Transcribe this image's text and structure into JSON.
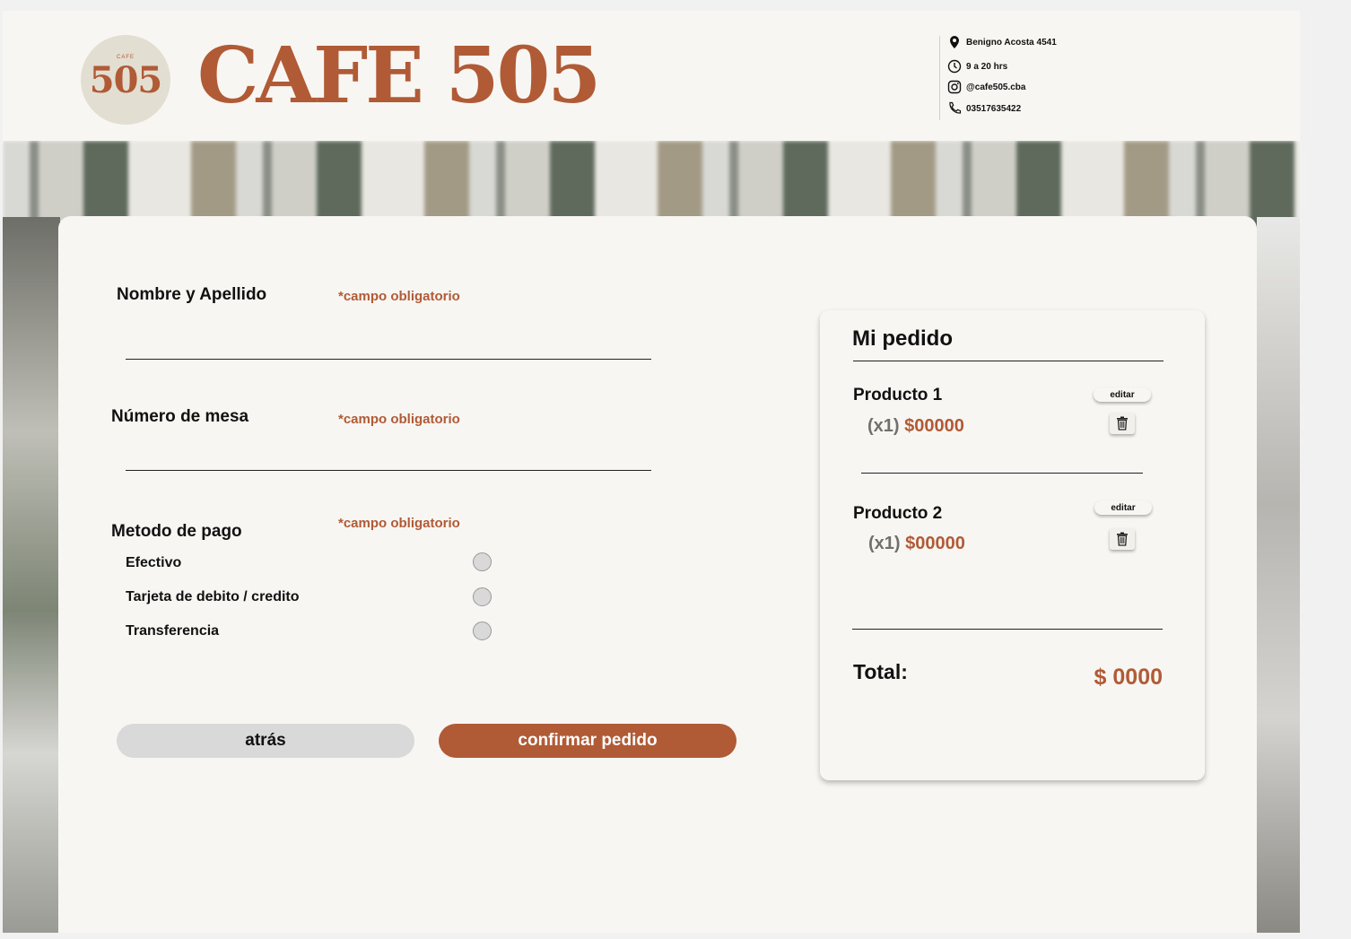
{
  "brand": {
    "badge_number": "505",
    "badge_small": "CAFE",
    "title": "CAFE 505",
    "accent_color": "#b15a36"
  },
  "contact": {
    "address": "Benigno Acosta 4541",
    "hours": "9 a 20 hrs",
    "instagram": "@cafe505.cba",
    "phone": "03517635422",
    "icons": [
      "location-pin-icon",
      "clock-icon",
      "instagram-icon",
      "phone-icon"
    ]
  },
  "form": {
    "name": {
      "label": "Nombre y Apellido",
      "required": "*campo obligatorio",
      "value": ""
    },
    "table": {
      "label": "Número de mesa",
      "required": "*campo obligatorio",
      "value": ""
    },
    "payment": {
      "label": "Metodo de pago",
      "required": "*campo obligatorio",
      "options": [
        "Efectivo",
        "Tarjeta de debito / credito",
        "Transferencia"
      ]
    },
    "back_label": "atrás",
    "confirm_label": "confirmar pedido"
  },
  "order": {
    "title": "Mi pedido",
    "items": [
      {
        "name": "Producto 1",
        "qty": "(x1)",
        "price": "$00000",
        "edit_label": "editar"
      },
      {
        "name": "Producto 2",
        "qty": "(x1)",
        "price": "$00000",
        "edit_label": "editar"
      }
    ],
    "total_label": "Total:",
    "total_value": "$ 0000"
  }
}
